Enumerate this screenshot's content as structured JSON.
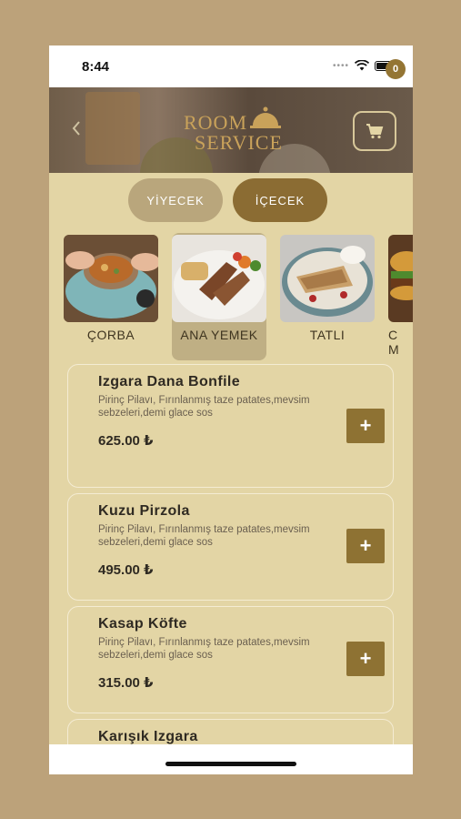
{
  "status": {
    "time": "8:44"
  },
  "header": {
    "logo_line1": "ROOM",
    "logo_line2": "SERVICE",
    "cart_count": "0"
  },
  "tabs": [
    {
      "label": "YİYECEK"
    },
    {
      "label": "İÇECEK"
    }
  ],
  "categories": [
    {
      "label": "ÇORBA"
    },
    {
      "label": "ANA YEMEK"
    },
    {
      "label": "TATLI"
    },
    {
      "label": "C\nM"
    }
  ],
  "items": [
    {
      "name": "Izgara Dana Bonfile",
      "desc": "Pirinç Pilavı, Fırınlanmış taze patates,mevsim sebzeleri,demi glace sos",
      "price": "625.00 ₺",
      "add": "+"
    },
    {
      "name": "Kuzu Pirzola",
      "desc": "Pirinç Pilavı, Fırınlanmış taze patates,mevsim sebzeleri,demi glace sos",
      "price": "495.00 ₺",
      "add": "+"
    },
    {
      "name": "Kasap Köfte",
      "desc": "Pirinç Pilavı, Fırınlanmış taze patates,mevsim sebzeleri,demi glace sos",
      "price": "315.00 ₺",
      "add": "+"
    },
    {
      "name": "Karışık Izgara"
    }
  ],
  "colors": {
    "background": "#bca27a",
    "panel": "#e3d5a5",
    "accent": "#8e7233",
    "tab_inactive": "#b9a67c"
  }
}
